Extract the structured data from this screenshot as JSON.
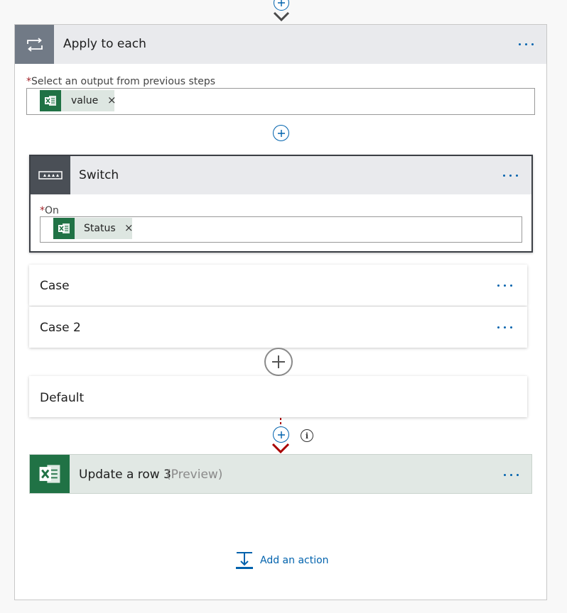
{
  "apply_to_each": {
    "title": "Apply to each",
    "field_label": "Select an output from previous steps",
    "required_mark": "*",
    "token_label": "value",
    "token_remove": "×"
  },
  "switch": {
    "title": "Switch",
    "field_label": "On",
    "required_mark": "*",
    "token_label": "Status",
    "token_remove": "×"
  },
  "cases": [
    {
      "label": "Case"
    },
    {
      "label": "Case 2"
    }
  ],
  "default_case": {
    "label": "Default"
  },
  "update_row": {
    "title": "Update a row 3",
    "badge": "(Preview)"
  },
  "add_action": {
    "label": "Add an action"
  },
  "colors": {
    "accent": "#0062ad",
    "excel_green": "#207245",
    "loop_header_icon_bg": "#717a86",
    "switch_icon_bg": "#4a4f56",
    "header_bg": "#e9eaed",
    "token_bg": "#dde6e1",
    "required_red": "#a4262c",
    "connector_red": "#a80000",
    "excel_card_bg": "#e1e8e4"
  },
  "icons": {
    "loop": "loop-icon",
    "switch": "switch-icon",
    "excel": "excel-icon",
    "add": "plus-icon",
    "info": "info-icon",
    "add_action": "add-action-icon",
    "more": "more-options-icon",
    "remove": "close-icon"
  }
}
